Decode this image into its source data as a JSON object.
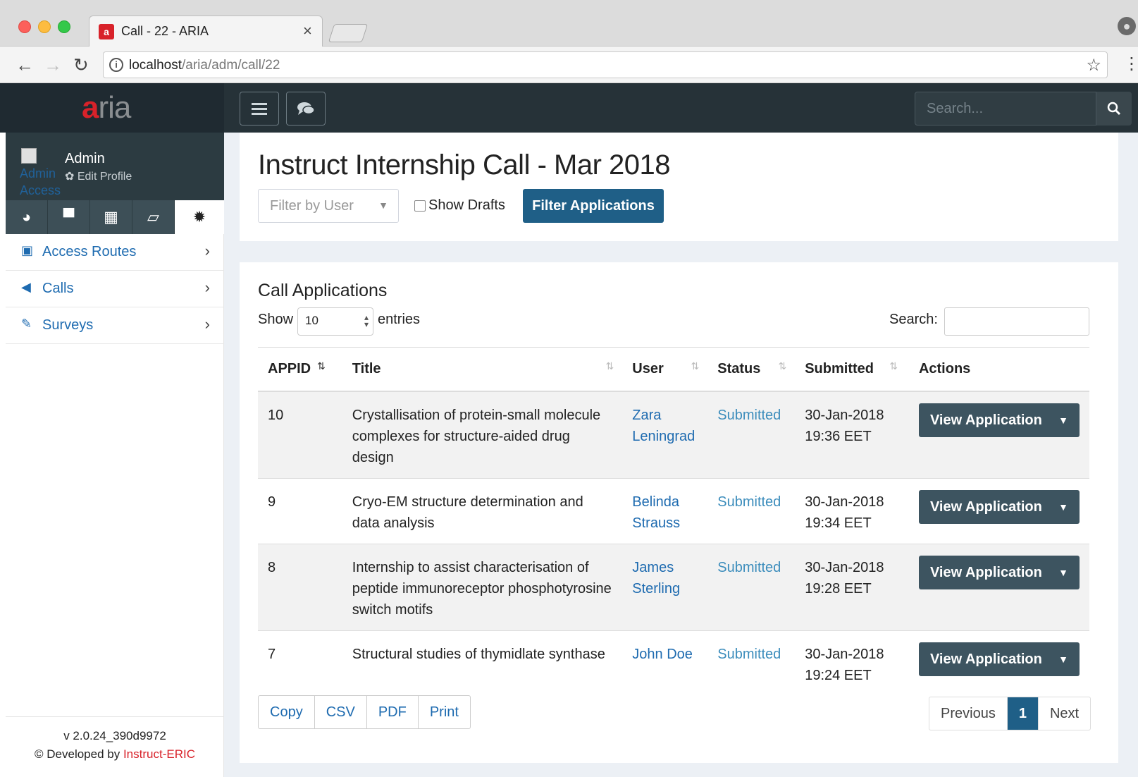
{
  "browser": {
    "tab_title": "Call - 22 - ARIA",
    "tab_close": "×",
    "url_host": "localhost",
    "url_path": "/aria/adm/call/22"
  },
  "app": {
    "logo_a": "a",
    "logo_rest": "ria",
    "top_search_placeholder": "Search..."
  },
  "sidebar": {
    "user_name": "Admin",
    "avatar_alt": "Admin Access",
    "edit_profile": "Edit Profile",
    "items": [
      {
        "label": "Access Routes",
        "icon": "ticket-icon"
      },
      {
        "label": "Calls",
        "icon": "bullhorn-icon"
      },
      {
        "label": "Surveys",
        "icon": "edit-icon"
      }
    ],
    "version": "v 2.0.24_390d9972",
    "developed_by": "© Developed by ",
    "developer": "Instruct-ERIC"
  },
  "header": {
    "title": "Instruct Internship Call - Mar 2018",
    "filter_user_placeholder": "Filter by User",
    "show_drafts": "Show Drafts",
    "filter_button": "Filter Applications"
  },
  "applications": {
    "title": "Call Applications",
    "show": "Show",
    "length": "10",
    "entries": "entries",
    "search": "Search:",
    "columns": [
      "APPID",
      "Title",
      "User",
      "Status",
      "Submitted",
      "Actions"
    ],
    "rows": [
      {
        "id": "10",
        "title": "Crystallisation of protein-small molecule complexes for structure-aided drug design",
        "user": "Zara Leningrad",
        "status": "Submitted",
        "submitted": "30-Jan-2018 19:36 EET",
        "action": "View Application"
      },
      {
        "id": "9",
        "title": "Cryo-EM structure determination and data analysis",
        "user": "Belinda Strauss",
        "status": "Submitted",
        "submitted": "30-Jan-2018 19:34 EET",
        "action": "View Application"
      },
      {
        "id": "8",
        "title": "Internship to assist characterisation of peptide immunoreceptor phosphotyrosine switch motifs",
        "user": "James Sterling",
        "status": "Submitted",
        "submitted": "30-Jan-2018 19:28 EET",
        "action": "View Application"
      },
      {
        "id": "7",
        "title": "Structural studies of thymidlate synthase",
        "user": "John Doe",
        "status": "Submitted",
        "submitted": "30-Jan-2018 19:24 EET",
        "action": "View Application"
      }
    ],
    "export_buttons": [
      "Copy",
      "CSV",
      "PDF",
      "Print"
    ],
    "pager": {
      "previous": "Previous",
      "current": "1",
      "next": "Next"
    }
  },
  "colors": {
    "sidebar_dark": "#2c3b41",
    "topnav": "#263238",
    "primary_button": "#1f5f87",
    "link": "#1e6bb0",
    "brand_red": "#d8222a"
  }
}
